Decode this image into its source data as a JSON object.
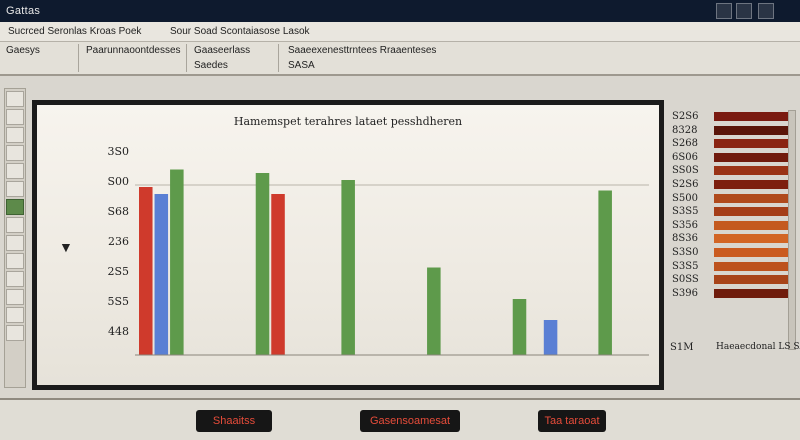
{
  "window": {
    "title": "Gattas"
  },
  "menu": {
    "items": [
      "Sucrced Seronlas Kroas Poek",
      "Sour Soad Scontaiasose Lasok"
    ]
  },
  "toolbar": {
    "groups": [
      {
        "label": "Gaesys",
        "sub": ""
      },
      {
        "label": "Paarunnaoontdesses",
        "sub": ""
      },
      {
        "label": "Gaaseerlass",
        "sub": "Saedes"
      },
      {
        "label": "Saaeexenesttrntees Rraaenteses",
        "sub": "SASA"
      }
    ]
  },
  "chart_data": {
    "type": "bar",
    "title": "Hamemspet terahres lataet pesshdheren",
    "y_tick_labels": [
      "3S0",
      "S00",
      "S68",
      "236",
      "2S5",
      "5S5",
      "448"
    ],
    "series": [
      {
        "color": "#cf3a2c",
        "values": [
          4.8,
          0,
          0,
          0,
          0,
          0
        ]
      },
      {
        "color": "#5a7fd4",
        "values": [
          4.6,
          0,
          0,
          0,
          0,
          0
        ]
      },
      {
        "color": "#5e9a4b",
        "values": [
          5.3,
          5.2,
          5.0,
          2.5,
          1.6,
          4.7
        ]
      },
      {
        "color": "#cf3a2c",
        "values": [
          0,
          4.6,
          0,
          0,
          0,
          0
        ]
      },
      {
        "color": "#5a7fd4",
        "values": [
          0,
          0,
          0,
          0,
          1.0,
          0
        ]
      }
    ]
  },
  "right_panel": {
    "rows": [
      {
        "label": "S2S6",
        "color": "#7a1a10"
      },
      {
        "label": "8328",
        "color": "#5a1509"
      },
      {
        "label": "S268",
        "color": "#8a2412"
      },
      {
        "label": "6S06",
        "color": "#701a0c"
      },
      {
        "label": "SS0S",
        "color": "#9a3316"
      },
      {
        "label": "S2S6",
        "color": "#7d1f0e"
      },
      {
        "label": "S500",
        "color": "#b04a1c"
      },
      {
        "label": "S3S5",
        "color": "#a53e18"
      },
      {
        "label": "S356",
        "color": "#c45a1f"
      },
      {
        "label": "8S36",
        "color": "#d26524"
      },
      {
        "label": "S3S0",
        "color": "#ca5b20"
      },
      {
        "label": "S3S5",
        "color": "#bd521d"
      },
      {
        "label": "S0SS",
        "color": "#a84419"
      },
      {
        "label": "S396",
        "color": "#6f1c0c"
      }
    ],
    "footer_label": "S1M",
    "footer_text": "Haeaecdonal LS SAS"
  },
  "status": {
    "buttons": [
      "Shaaitss",
      "Gasensoamesat",
      "Taa taraoat"
    ]
  }
}
